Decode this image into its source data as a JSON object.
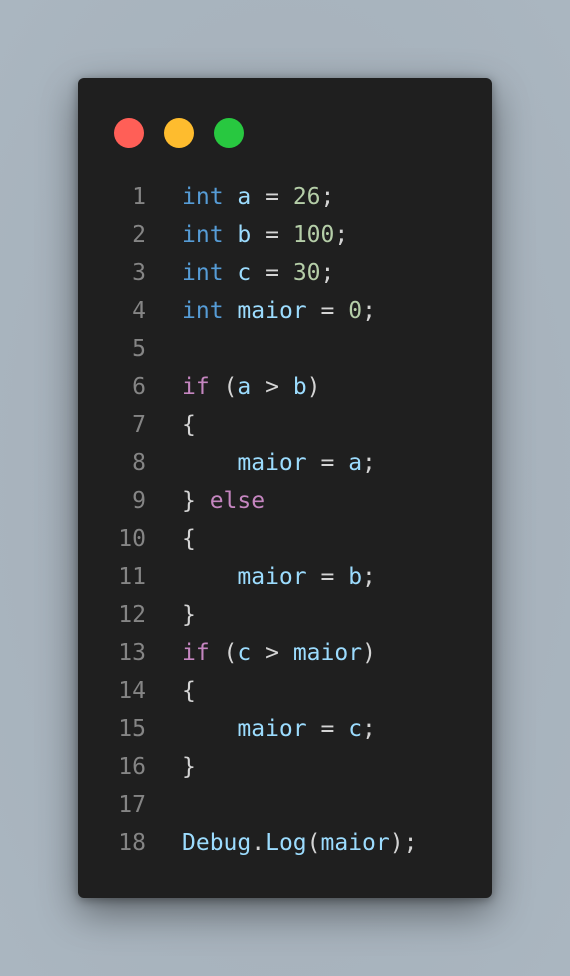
{
  "window": {
    "traffic_lights": [
      {
        "name": "close",
        "color": "#ff5f57"
      },
      {
        "name": "minimize",
        "color": "#febc2e"
      },
      {
        "name": "maximize",
        "color": "#28c840"
      }
    ]
  },
  "colors": {
    "background": "#1f1f1f",
    "keyword": "#569cd6",
    "control": "#c586c0",
    "variable": "#9cdcfe",
    "number": "#b5cea8",
    "plain": "#d4d4d4",
    "line_number": "#858585"
  },
  "code": {
    "lines": [
      {
        "number": "1",
        "tokens": [
          {
            "t": "int",
            "c": "kw"
          },
          {
            "t": " ",
            "c": "pl"
          },
          {
            "t": "a",
            "c": "var"
          },
          {
            "t": " = ",
            "c": "pl"
          },
          {
            "t": "26",
            "c": "num"
          },
          {
            "t": ";",
            "c": "pl"
          }
        ]
      },
      {
        "number": "2",
        "tokens": [
          {
            "t": "int",
            "c": "kw"
          },
          {
            "t": " ",
            "c": "pl"
          },
          {
            "t": "b",
            "c": "var"
          },
          {
            "t": " = ",
            "c": "pl"
          },
          {
            "t": "100",
            "c": "num"
          },
          {
            "t": ";",
            "c": "pl"
          }
        ]
      },
      {
        "number": "3",
        "tokens": [
          {
            "t": "int",
            "c": "kw"
          },
          {
            "t": " ",
            "c": "pl"
          },
          {
            "t": "c",
            "c": "var"
          },
          {
            "t": " = ",
            "c": "pl"
          },
          {
            "t": "30",
            "c": "num"
          },
          {
            "t": ";",
            "c": "pl"
          }
        ]
      },
      {
        "number": "4",
        "tokens": [
          {
            "t": "int",
            "c": "kw"
          },
          {
            "t": " ",
            "c": "pl"
          },
          {
            "t": "maior",
            "c": "var"
          },
          {
            "t": " = ",
            "c": "pl"
          },
          {
            "t": "0",
            "c": "num"
          },
          {
            "t": ";",
            "c": "pl"
          }
        ]
      },
      {
        "number": "5",
        "tokens": []
      },
      {
        "number": "6",
        "tokens": [
          {
            "t": "if",
            "c": "ctl"
          },
          {
            "t": " (",
            "c": "pl"
          },
          {
            "t": "a",
            "c": "var"
          },
          {
            "t": " > ",
            "c": "pl"
          },
          {
            "t": "b",
            "c": "var"
          },
          {
            "t": ")",
            "c": "pl"
          }
        ]
      },
      {
        "number": "7",
        "tokens": [
          {
            "t": "{",
            "c": "pl"
          }
        ]
      },
      {
        "number": "8",
        "tokens": [
          {
            "t": "    ",
            "c": "pl"
          },
          {
            "t": "maior",
            "c": "var"
          },
          {
            "t": " = ",
            "c": "pl"
          },
          {
            "t": "a",
            "c": "var"
          },
          {
            "t": ";",
            "c": "pl"
          }
        ]
      },
      {
        "number": "9",
        "tokens": [
          {
            "t": "} ",
            "c": "pl"
          },
          {
            "t": "else",
            "c": "ctl"
          }
        ]
      },
      {
        "number": "10",
        "tokens": [
          {
            "t": "{",
            "c": "pl"
          }
        ]
      },
      {
        "number": "11",
        "tokens": [
          {
            "t": "    ",
            "c": "pl"
          },
          {
            "t": "maior",
            "c": "var"
          },
          {
            "t": " = ",
            "c": "pl"
          },
          {
            "t": "b",
            "c": "var"
          },
          {
            "t": ";",
            "c": "pl"
          }
        ]
      },
      {
        "number": "12",
        "tokens": [
          {
            "t": "}",
            "c": "pl"
          }
        ]
      },
      {
        "number": "13",
        "tokens": [
          {
            "t": "if",
            "c": "ctl"
          },
          {
            "t": " (",
            "c": "pl"
          },
          {
            "t": "c",
            "c": "var"
          },
          {
            "t": " > ",
            "c": "pl"
          },
          {
            "t": "maior",
            "c": "var"
          },
          {
            "t": ")",
            "c": "pl"
          }
        ]
      },
      {
        "number": "14",
        "tokens": [
          {
            "t": "{",
            "c": "pl"
          }
        ]
      },
      {
        "number": "15",
        "tokens": [
          {
            "t": "    ",
            "c": "pl"
          },
          {
            "t": "maior",
            "c": "var"
          },
          {
            "t": " = ",
            "c": "pl"
          },
          {
            "t": "c",
            "c": "var"
          },
          {
            "t": ";",
            "c": "pl"
          }
        ]
      },
      {
        "number": "16",
        "tokens": [
          {
            "t": "}",
            "c": "pl"
          }
        ]
      },
      {
        "number": "17",
        "tokens": []
      },
      {
        "number": "18",
        "tokens": [
          {
            "t": "Debug",
            "c": "var"
          },
          {
            "t": ".",
            "c": "pl"
          },
          {
            "t": "Log",
            "c": "var"
          },
          {
            "t": "(",
            "c": "pl"
          },
          {
            "t": "maior",
            "c": "var"
          },
          {
            "t": ");",
            "c": "pl"
          }
        ]
      }
    ]
  }
}
